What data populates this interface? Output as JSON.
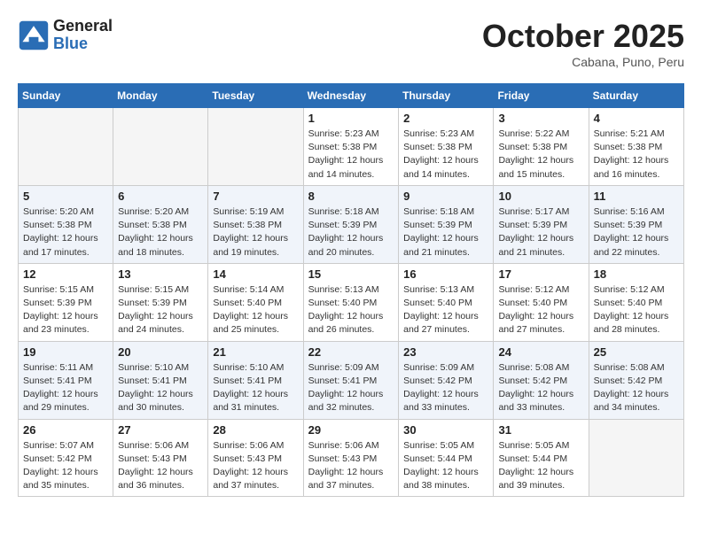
{
  "header": {
    "logo_line1": "General",
    "logo_line2": "Blue",
    "month": "October 2025",
    "location": "Cabana, Puno, Peru"
  },
  "weekdays": [
    "Sunday",
    "Monday",
    "Tuesday",
    "Wednesday",
    "Thursday",
    "Friday",
    "Saturday"
  ],
  "weeks": [
    [
      {
        "day": "",
        "info": ""
      },
      {
        "day": "",
        "info": ""
      },
      {
        "day": "",
        "info": ""
      },
      {
        "day": "1",
        "info": "Sunrise: 5:23 AM\nSunset: 5:38 PM\nDaylight: 12 hours\nand 14 minutes."
      },
      {
        "day": "2",
        "info": "Sunrise: 5:23 AM\nSunset: 5:38 PM\nDaylight: 12 hours\nand 14 minutes."
      },
      {
        "day": "3",
        "info": "Sunrise: 5:22 AM\nSunset: 5:38 PM\nDaylight: 12 hours\nand 15 minutes."
      },
      {
        "day": "4",
        "info": "Sunrise: 5:21 AM\nSunset: 5:38 PM\nDaylight: 12 hours\nand 16 minutes."
      }
    ],
    [
      {
        "day": "5",
        "info": "Sunrise: 5:20 AM\nSunset: 5:38 PM\nDaylight: 12 hours\nand 17 minutes."
      },
      {
        "day": "6",
        "info": "Sunrise: 5:20 AM\nSunset: 5:38 PM\nDaylight: 12 hours\nand 18 minutes."
      },
      {
        "day": "7",
        "info": "Sunrise: 5:19 AM\nSunset: 5:38 PM\nDaylight: 12 hours\nand 19 minutes."
      },
      {
        "day": "8",
        "info": "Sunrise: 5:18 AM\nSunset: 5:39 PM\nDaylight: 12 hours\nand 20 minutes."
      },
      {
        "day": "9",
        "info": "Sunrise: 5:18 AM\nSunset: 5:39 PM\nDaylight: 12 hours\nand 21 minutes."
      },
      {
        "day": "10",
        "info": "Sunrise: 5:17 AM\nSunset: 5:39 PM\nDaylight: 12 hours\nand 21 minutes."
      },
      {
        "day": "11",
        "info": "Sunrise: 5:16 AM\nSunset: 5:39 PM\nDaylight: 12 hours\nand 22 minutes."
      }
    ],
    [
      {
        "day": "12",
        "info": "Sunrise: 5:15 AM\nSunset: 5:39 PM\nDaylight: 12 hours\nand 23 minutes."
      },
      {
        "day": "13",
        "info": "Sunrise: 5:15 AM\nSunset: 5:39 PM\nDaylight: 12 hours\nand 24 minutes."
      },
      {
        "day": "14",
        "info": "Sunrise: 5:14 AM\nSunset: 5:40 PM\nDaylight: 12 hours\nand 25 minutes."
      },
      {
        "day": "15",
        "info": "Sunrise: 5:13 AM\nSunset: 5:40 PM\nDaylight: 12 hours\nand 26 minutes."
      },
      {
        "day": "16",
        "info": "Sunrise: 5:13 AM\nSunset: 5:40 PM\nDaylight: 12 hours\nand 27 minutes."
      },
      {
        "day": "17",
        "info": "Sunrise: 5:12 AM\nSunset: 5:40 PM\nDaylight: 12 hours\nand 27 minutes."
      },
      {
        "day": "18",
        "info": "Sunrise: 5:12 AM\nSunset: 5:40 PM\nDaylight: 12 hours\nand 28 minutes."
      }
    ],
    [
      {
        "day": "19",
        "info": "Sunrise: 5:11 AM\nSunset: 5:41 PM\nDaylight: 12 hours\nand 29 minutes."
      },
      {
        "day": "20",
        "info": "Sunrise: 5:10 AM\nSunset: 5:41 PM\nDaylight: 12 hours\nand 30 minutes."
      },
      {
        "day": "21",
        "info": "Sunrise: 5:10 AM\nSunset: 5:41 PM\nDaylight: 12 hours\nand 31 minutes."
      },
      {
        "day": "22",
        "info": "Sunrise: 5:09 AM\nSunset: 5:41 PM\nDaylight: 12 hours\nand 32 minutes."
      },
      {
        "day": "23",
        "info": "Sunrise: 5:09 AM\nSunset: 5:42 PM\nDaylight: 12 hours\nand 33 minutes."
      },
      {
        "day": "24",
        "info": "Sunrise: 5:08 AM\nSunset: 5:42 PM\nDaylight: 12 hours\nand 33 minutes."
      },
      {
        "day": "25",
        "info": "Sunrise: 5:08 AM\nSunset: 5:42 PM\nDaylight: 12 hours\nand 34 minutes."
      }
    ],
    [
      {
        "day": "26",
        "info": "Sunrise: 5:07 AM\nSunset: 5:42 PM\nDaylight: 12 hours\nand 35 minutes."
      },
      {
        "day": "27",
        "info": "Sunrise: 5:06 AM\nSunset: 5:43 PM\nDaylight: 12 hours\nand 36 minutes."
      },
      {
        "day": "28",
        "info": "Sunrise: 5:06 AM\nSunset: 5:43 PM\nDaylight: 12 hours\nand 37 minutes."
      },
      {
        "day": "29",
        "info": "Sunrise: 5:06 AM\nSunset: 5:43 PM\nDaylight: 12 hours\nand 37 minutes."
      },
      {
        "day": "30",
        "info": "Sunrise: 5:05 AM\nSunset: 5:44 PM\nDaylight: 12 hours\nand 38 minutes."
      },
      {
        "day": "31",
        "info": "Sunrise: 5:05 AM\nSunset: 5:44 PM\nDaylight: 12 hours\nand 39 minutes."
      },
      {
        "day": "",
        "info": ""
      }
    ]
  ]
}
